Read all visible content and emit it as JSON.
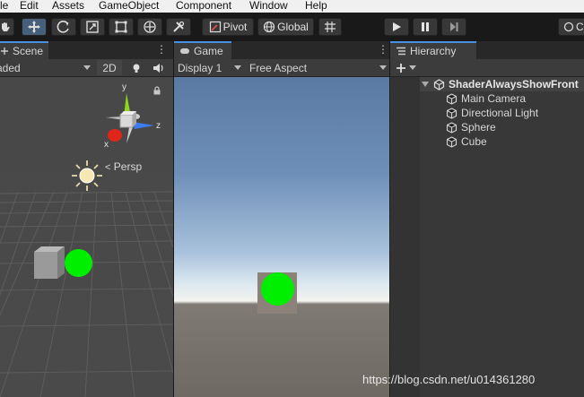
{
  "menu": [
    "le",
    "Edit",
    "Assets",
    "GameObject",
    "Component",
    "Window",
    "Help"
  ],
  "toolbar": {
    "tools": [
      "hand-tool",
      "move-tool",
      "rotate-tool",
      "scale-tool",
      "rect-tool",
      "transform-tool",
      "custom-tool"
    ],
    "pivot_label": "Pivot",
    "global_label": "Global",
    "right_partial_label": "C"
  },
  "scene": {
    "tab_label": "Scene",
    "shading_value": "aded",
    "mode_2d_label": "2D",
    "persp_label": "Persp",
    "gizmo": {
      "y": "y",
      "x": "x",
      "z": "z"
    }
  },
  "game": {
    "tab_label": "Game",
    "display_value": "Display 1",
    "aspect_value": "Free Aspect"
  },
  "hierarchy": {
    "tab_label": "Hierarchy",
    "scene_name": "ShaderAlwaysShowFront",
    "items": [
      "Main Camera",
      "Directional Light",
      "Sphere",
      "Cube"
    ]
  },
  "colors": {
    "sphere": "#00ee00",
    "accent": "#4a8fe0",
    "active_tool": "#46607c"
  },
  "watermark": "https://blog.csdn.net/u014361280"
}
